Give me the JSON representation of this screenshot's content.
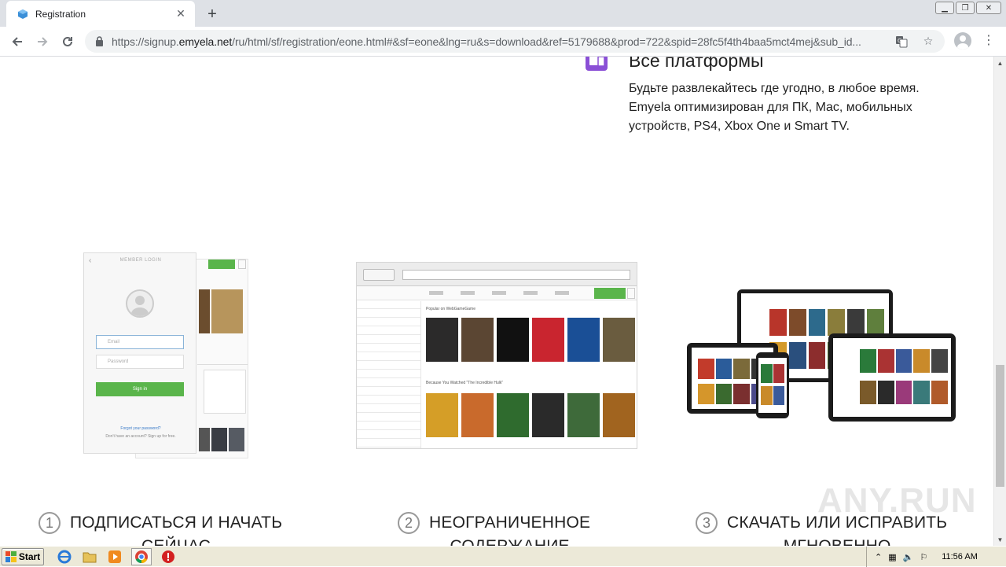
{
  "browser": {
    "tab_title": "Registration",
    "new_tab_symbol": "+",
    "url_prefix": "https://signup.",
    "url_host": "emyela.net",
    "url_path": "/ru/html/sf/registration/eone.html#&sf=eone&lng=ru&s=download&ref=5179688&prod=722&spid=28fc5f4th4baa5mct4mej&sub_id..."
  },
  "feature": {
    "title": "Все платформы",
    "text": "Будьте развлекайтесь где угодно, в любое время. Emyela оптимизирован для ПК, Mac, мобильных устройств, PS4, Xbox One и Smart TV.",
    "icon_color": "#8a4fd6"
  },
  "screenshots": {
    "login": {
      "header": "MEMBER LOGIN",
      "email_placeholder": "Email",
      "password_placeholder": "Password",
      "signin": "Sign in",
      "forgot": "Forgot your password?",
      "signup_prompt": "Don't have an account? Sign up for free.",
      "accent": "#5ab54b"
    },
    "browser": {
      "section1": "Popular on WebGameGame",
      "section2": "Because You Watched \"The Incredible Hulk\""
    }
  },
  "steps": [
    {
      "num": "1",
      "label_line1": "ПОДПИСАТЬСЯ И НАЧАТЬ",
      "label_line2": "СЕЙЧАС"
    },
    {
      "num": "2",
      "label_line1": "НЕОГРАНИЧЕННОЕ",
      "label_line2": "СОДЕРЖАНИЕ"
    },
    {
      "num": "3",
      "label_line1": "СКАЧАТЬ ИЛИ ИСПРАВИТЬ",
      "label_line2": "МГНОВЕННО"
    }
  ],
  "watermark": "ANY.RUN",
  "taskbar": {
    "start_label": "Start",
    "clock": "11:56 AM"
  }
}
